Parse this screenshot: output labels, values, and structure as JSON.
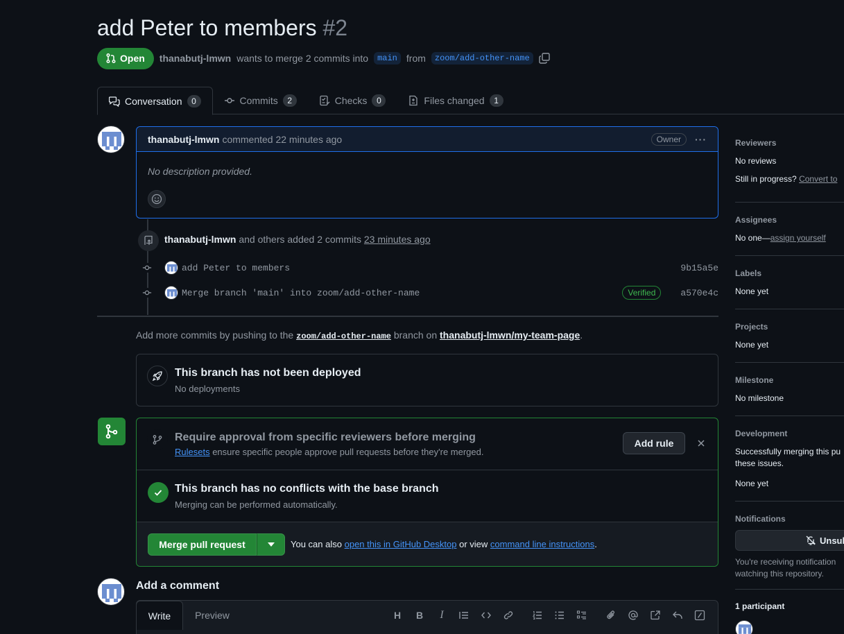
{
  "pr": {
    "title": "add Peter to members",
    "number": "#2",
    "state": "Open",
    "author": "thanabutj-lmwn",
    "merge_text": "wants to merge 2 commits into",
    "base_branch": "main",
    "from_text": "from",
    "head_branch": "zoom/add-other-name"
  },
  "tabs": [
    {
      "label": "Conversation",
      "count": "0"
    },
    {
      "label": "Commits",
      "count": "2"
    },
    {
      "label": "Checks",
      "count": "0"
    },
    {
      "label": "Files changed",
      "count": "1"
    }
  ],
  "comment": {
    "author": "thanabutj-lmwn",
    "action": "commented 22 minutes ago",
    "role": "Owner",
    "body": "No description provided."
  },
  "commits_event": {
    "author": "thanabutj-lmwn",
    "text": "and others added 2 commits",
    "time": "23 minutes ago",
    "commits": [
      {
        "message": "add Peter to members",
        "sha": "9b15a5e",
        "verified": ""
      },
      {
        "message": "Merge branch 'main' into zoom/add-other-name",
        "sha": "a570e4c",
        "verified": "Verified"
      }
    ]
  },
  "push_hint": {
    "prefix": "Add more commits by pushing to the",
    "branch": "zoom/add-other-name",
    "middle": "branch on",
    "repo": "thanabutj-lmwn/my-team-page",
    "suffix": "."
  },
  "deploy": {
    "title": "This branch has not been deployed",
    "subtitle": "No deployments"
  },
  "merge": {
    "ruleset_title": "Require approval from specific reviewers before merging",
    "ruleset_link": "Rulesets",
    "ruleset_desc": "ensure specific people approve pull requests before they're merged.",
    "add_rule": "Add rule",
    "conflict_title": "This branch has no conflicts with the base branch",
    "conflict_sub": "Merging can be performed automatically.",
    "merge_button": "Merge pull request",
    "also_text": "You can also",
    "desktop_link": "open this in GitHub Desktop",
    "or_view": "or view",
    "cli_link": "command line instructions",
    "end": "."
  },
  "add_comment": {
    "title": "Add a comment",
    "write_tab": "Write",
    "preview_tab": "Preview"
  },
  "sidebar": {
    "reviewers_title": "Reviewers",
    "reviewers_value": "No reviews",
    "in_progress": "Still in progress?",
    "convert": "Convert to",
    "assignees_title": "Assignees",
    "assignees_value": "No one—",
    "assign_yourself": "assign yourself",
    "labels_title": "Labels",
    "labels_value": "None yet",
    "projects_title": "Projects",
    "projects_value": "None yet",
    "milestone_title": "Milestone",
    "milestone_value": "No milestone",
    "development_title": "Development",
    "development_line1": "Successfully merging this pu",
    "development_line2": "these issues.",
    "development_value": "None yet",
    "notifications_title": "Notifications",
    "unsubscribe": "Unsub",
    "notif_line1": "You're receiving notification",
    "notif_line2": "watching this repository.",
    "participants": "1 participant"
  },
  "colors": {
    "accent": "#4493f8",
    "success": "#238636",
    "bg": "#0d1117"
  }
}
